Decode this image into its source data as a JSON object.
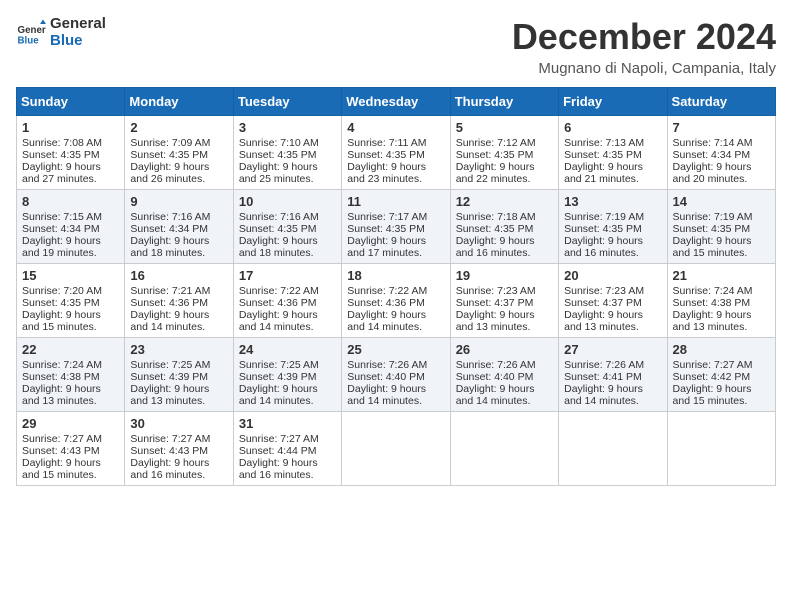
{
  "header": {
    "logo_line1": "General",
    "logo_line2": "Blue",
    "month_title": "December 2024",
    "location": "Mugnano di Napoli, Campania, Italy"
  },
  "days_of_week": [
    "Sunday",
    "Monday",
    "Tuesday",
    "Wednesday",
    "Thursday",
    "Friday",
    "Saturday"
  ],
  "weeks": [
    [
      {
        "day": "1",
        "sunrise": "Sunrise: 7:08 AM",
        "sunset": "Sunset: 4:35 PM",
        "daylight": "Daylight: 9 hours and 27 minutes."
      },
      {
        "day": "2",
        "sunrise": "Sunrise: 7:09 AM",
        "sunset": "Sunset: 4:35 PM",
        "daylight": "Daylight: 9 hours and 26 minutes."
      },
      {
        "day": "3",
        "sunrise": "Sunrise: 7:10 AM",
        "sunset": "Sunset: 4:35 PM",
        "daylight": "Daylight: 9 hours and 25 minutes."
      },
      {
        "day": "4",
        "sunrise": "Sunrise: 7:11 AM",
        "sunset": "Sunset: 4:35 PM",
        "daylight": "Daylight: 9 hours and 23 minutes."
      },
      {
        "day": "5",
        "sunrise": "Sunrise: 7:12 AM",
        "sunset": "Sunset: 4:35 PM",
        "daylight": "Daylight: 9 hours and 22 minutes."
      },
      {
        "day": "6",
        "sunrise": "Sunrise: 7:13 AM",
        "sunset": "Sunset: 4:35 PM",
        "daylight": "Daylight: 9 hours and 21 minutes."
      },
      {
        "day": "7",
        "sunrise": "Sunrise: 7:14 AM",
        "sunset": "Sunset: 4:34 PM",
        "daylight": "Daylight: 9 hours and 20 minutes."
      }
    ],
    [
      {
        "day": "8",
        "sunrise": "Sunrise: 7:15 AM",
        "sunset": "Sunset: 4:34 PM",
        "daylight": "Daylight: 9 hours and 19 minutes."
      },
      {
        "day": "9",
        "sunrise": "Sunrise: 7:16 AM",
        "sunset": "Sunset: 4:34 PM",
        "daylight": "Daylight: 9 hours and 18 minutes."
      },
      {
        "day": "10",
        "sunrise": "Sunrise: 7:16 AM",
        "sunset": "Sunset: 4:35 PM",
        "daylight": "Daylight: 9 hours and 18 minutes."
      },
      {
        "day": "11",
        "sunrise": "Sunrise: 7:17 AM",
        "sunset": "Sunset: 4:35 PM",
        "daylight": "Daylight: 9 hours and 17 minutes."
      },
      {
        "day": "12",
        "sunrise": "Sunrise: 7:18 AM",
        "sunset": "Sunset: 4:35 PM",
        "daylight": "Daylight: 9 hours and 16 minutes."
      },
      {
        "day": "13",
        "sunrise": "Sunrise: 7:19 AM",
        "sunset": "Sunset: 4:35 PM",
        "daylight": "Daylight: 9 hours and 16 minutes."
      },
      {
        "day": "14",
        "sunrise": "Sunrise: 7:19 AM",
        "sunset": "Sunset: 4:35 PM",
        "daylight": "Daylight: 9 hours and 15 minutes."
      }
    ],
    [
      {
        "day": "15",
        "sunrise": "Sunrise: 7:20 AM",
        "sunset": "Sunset: 4:35 PM",
        "daylight": "Daylight: 9 hours and 15 minutes."
      },
      {
        "day": "16",
        "sunrise": "Sunrise: 7:21 AM",
        "sunset": "Sunset: 4:36 PM",
        "daylight": "Daylight: 9 hours and 14 minutes."
      },
      {
        "day": "17",
        "sunrise": "Sunrise: 7:22 AM",
        "sunset": "Sunset: 4:36 PM",
        "daylight": "Daylight: 9 hours and 14 minutes."
      },
      {
        "day": "18",
        "sunrise": "Sunrise: 7:22 AM",
        "sunset": "Sunset: 4:36 PM",
        "daylight": "Daylight: 9 hours and 14 minutes."
      },
      {
        "day": "19",
        "sunrise": "Sunrise: 7:23 AM",
        "sunset": "Sunset: 4:37 PM",
        "daylight": "Daylight: 9 hours and 13 minutes."
      },
      {
        "day": "20",
        "sunrise": "Sunrise: 7:23 AM",
        "sunset": "Sunset: 4:37 PM",
        "daylight": "Daylight: 9 hours and 13 minutes."
      },
      {
        "day": "21",
        "sunrise": "Sunrise: 7:24 AM",
        "sunset": "Sunset: 4:38 PM",
        "daylight": "Daylight: 9 hours and 13 minutes."
      }
    ],
    [
      {
        "day": "22",
        "sunrise": "Sunrise: 7:24 AM",
        "sunset": "Sunset: 4:38 PM",
        "daylight": "Daylight: 9 hours and 13 minutes."
      },
      {
        "day": "23",
        "sunrise": "Sunrise: 7:25 AM",
        "sunset": "Sunset: 4:39 PM",
        "daylight": "Daylight: 9 hours and 13 minutes."
      },
      {
        "day": "24",
        "sunrise": "Sunrise: 7:25 AM",
        "sunset": "Sunset: 4:39 PM",
        "daylight": "Daylight: 9 hours and 14 minutes."
      },
      {
        "day": "25",
        "sunrise": "Sunrise: 7:26 AM",
        "sunset": "Sunset: 4:40 PM",
        "daylight": "Daylight: 9 hours and 14 minutes."
      },
      {
        "day": "26",
        "sunrise": "Sunrise: 7:26 AM",
        "sunset": "Sunset: 4:40 PM",
        "daylight": "Daylight: 9 hours and 14 minutes."
      },
      {
        "day": "27",
        "sunrise": "Sunrise: 7:26 AM",
        "sunset": "Sunset: 4:41 PM",
        "daylight": "Daylight: 9 hours and 14 minutes."
      },
      {
        "day": "28",
        "sunrise": "Sunrise: 7:27 AM",
        "sunset": "Sunset: 4:42 PM",
        "daylight": "Daylight: 9 hours and 15 minutes."
      }
    ],
    [
      {
        "day": "29",
        "sunrise": "Sunrise: 7:27 AM",
        "sunset": "Sunset: 4:43 PM",
        "daylight": "Daylight: 9 hours and 15 minutes."
      },
      {
        "day": "30",
        "sunrise": "Sunrise: 7:27 AM",
        "sunset": "Sunset: 4:43 PM",
        "daylight": "Daylight: 9 hours and 16 minutes."
      },
      {
        "day": "31",
        "sunrise": "Sunrise: 7:27 AM",
        "sunset": "Sunset: 4:44 PM",
        "daylight": "Daylight: 9 hours and 16 minutes."
      },
      null,
      null,
      null,
      null
    ]
  ]
}
